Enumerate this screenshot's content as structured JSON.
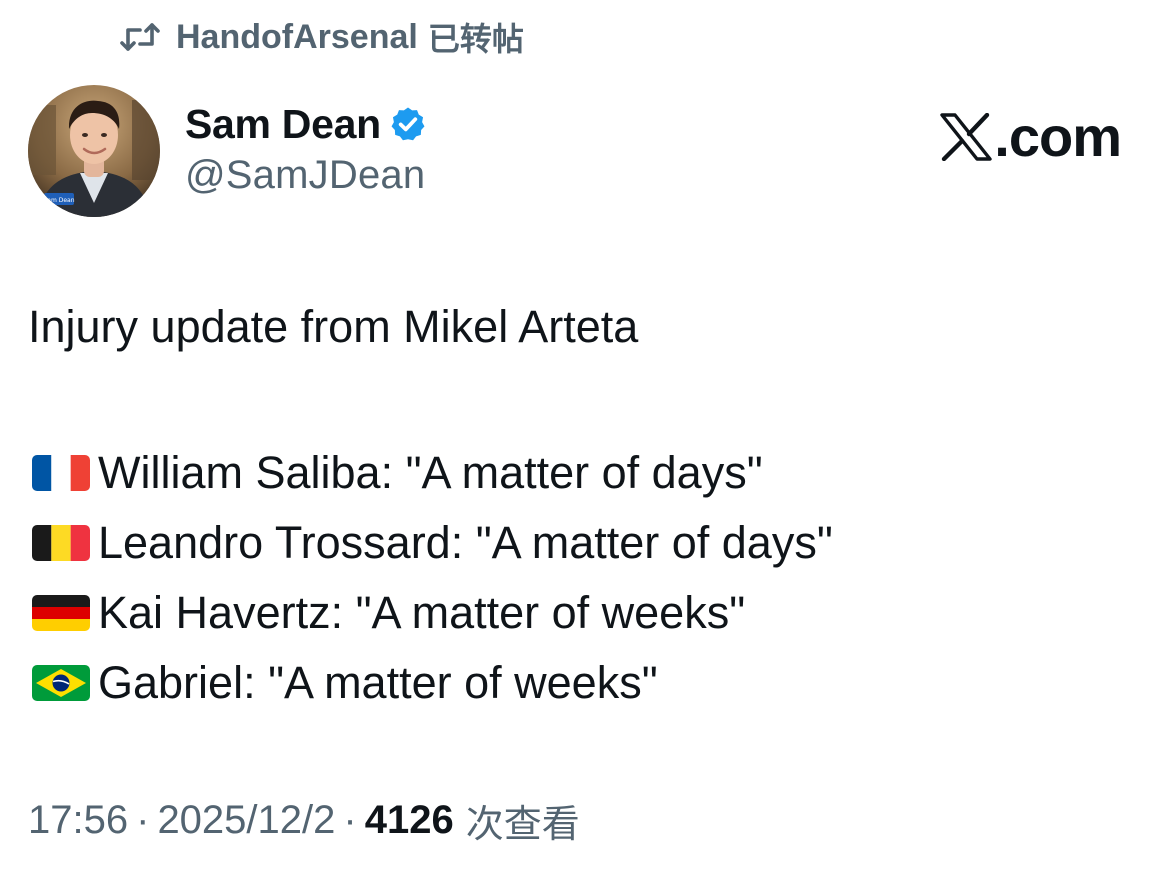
{
  "repost": {
    "icon": "repost-icon",
    "user": "HandofArsenal",
    "suffix": "已转帖"
  },
  "author": {
    "name": "Sam Dean",
    "handle": "@SamJDean",
    "verified_icon": "verified-badge-icon",
    "verified_color": "#1d9bf0",
    "avatar_badge_text": "Sam Dean"
  },
  "brand": {
    "logo_icon": "x-logo-icon",
    "domain_suffix": ".com"
  },
  "tweet": {
    "heading": "Injury update from Mikel Arteta",
    "players": [
      {
        "flag_icon": "france-flag-icon",
        "text": "William Saliba: \"A matter of days\""
      },
      {
        "flag_icon": "belgium-flag-icon",
        "text": "Leandro Trossard: \"A matter of days\""
      },
      {
        "flag_icon": "germany-flag-icon",
        "text": "Kai Havertz: \"A matter of weeks\""
      },
      {
        "flag_icon": "brazil-flag-icon",
        "text": "Gabriel: \"A matter of weeks\""
      }
    ]
  },
  "meta": {
    "time": "17:56",
    "separator": "·",
    "date": "2025/12/2",
    "view_count": "4126",
    "views_label": "次查看"
  },
  "colors": {
    "text_primary": "#0f1419",
    "text_secondary": "#536471",
    "background": "#ffffff"
  }
}
